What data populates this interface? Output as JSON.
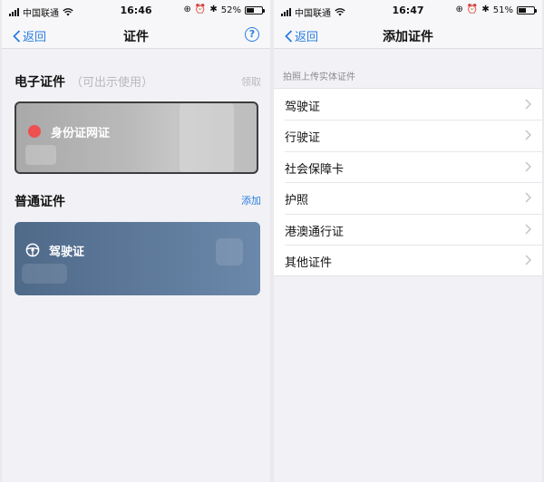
{
  "left": {
    "status": {
      "carrier": "中国联通",
      "time": "16:46",
      "battery": "52%",
      "battery_level": 0.52
    },
    "nav": {
      "back": "返回",
      "title": "证件"
    },
    "electronic": {
      "title": "电子证件",
      "hint": "（可出示使用）",
      "action": "领取",
      "card_label": "身份证网证"
    },
    "ordinary": {
      "title": "普通证件",
      "action": "添加",
      "card_label": "驾驶证"
    }
  },
  "right": {
    "status": {
      "carrier": "中国联通",
      "time": "16:47",
      "battery": "51%",
      "battery_level": 0.51
    },
    "nav": {
      "back": "返回",
      "title": "添加证件"
    },
    "group_label": "拍照上传实体证件",
    "items": [
      {
        "label": "驾驶证"
      },
      {
        "label": "行驶证"
      },
      {
        "label": "社会保障卡"
      },
      {
        "label": "护照"
      },
      {
        "label": "港澳通行证"
      },
      {
        "label": "其他证件"
      }
    ]
  },
  "colors": {
    "accent": "#2a7de1",
    "id_card_dot": "#ee5050",
    "drive_card": "#5d7899"
  }
}
